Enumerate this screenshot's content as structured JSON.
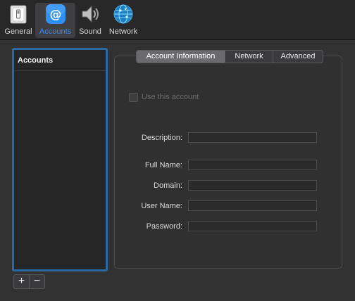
{
  "toolbar": {
    "items": [
      {
        "label": "General",
        "icon": "general-switch-icon",
        "selected": false
      },
      {
        "label": "Accounts",
        "icon": "at-sign-icon",
        "selected": true
      },
      {
        "label": "Sound",
        "icon": "speaker-icon",
        "selected": false
      },
      {
        "label": "Network",
        "icon": "globe-network-icon",
        "selected": false
      }
    ]
  },
  "accounts": {
    "header": "Accounts",
    "add_label": "+",
    "remove_label": "−"
  },
  "tabs": [
    {
      "label": "Account Information",
      "active": true
    },
    {
      "label": "Network",
      "active": false
    },
    {
      "label": "Advanced",
      "active": false
    }
  ],
  "form": {
    "use_account_label": "Use this account",
    "use_account_checked": false,
    "use_account_enabled": false,
    "fields": [
      {
        "label": "Description:",
        "value": ""
      },
      {
        "label": "Full Name:",
        "value": ""
      },
      {
        "label": "Domain:",
        "value": ""
      },
      {
        "label": "User Name:",
        "value": ""
      },
      {
        "label": "Password:",
        "value": ""
      }
    ]
  },
  "colors": {
    "accent": "#3f8ef3",
    "selection_border": "#2b69a5",
    "background": "#323233",
    "toolbar": "#282828"
  }
}
